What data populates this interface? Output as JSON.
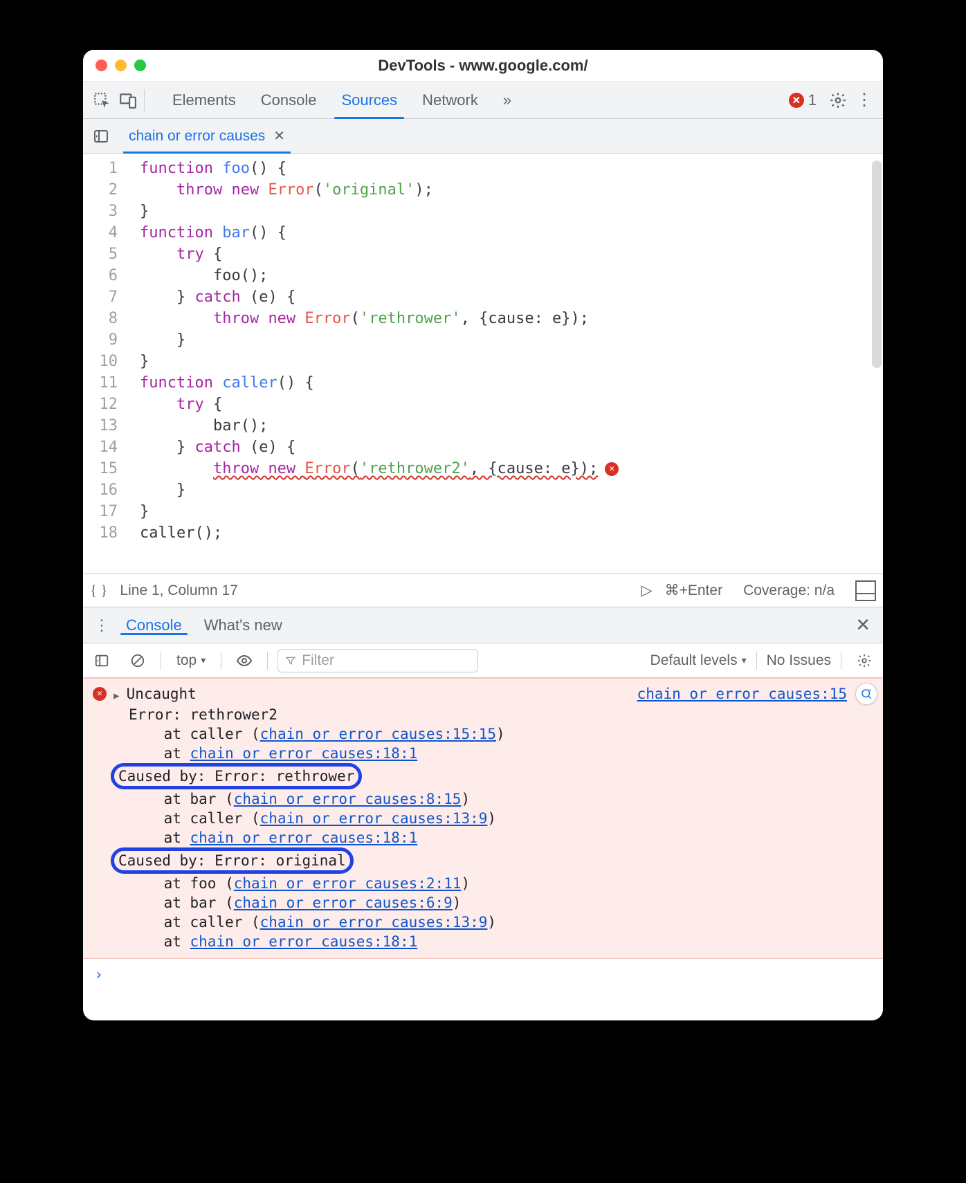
{
  "window": {
    "title": "DevTools - www.google.com/"
  },
  "toolbar": {
    "tabs": [
      "Elements",
      "Console",
      "Sources",
      "Network"
    ],
    "active_tab_index": 2,
    "overflow_glyph": "»",
    "error_count": "1"
  },
  "file_tabs": {
    "active": {
      "name": "chain or error causes",
      "close_glyph": "✕"
    }
  },
  "editor": {
    "line_numbers": [
      "1",
      "2",
      "3",
      "4",
      "5",
      "6",
      "7",
      "8",
      "9",
      "10",
      "11",
      "12",
      "13",
      "14",
      "15",
      "16",
      "17",
      "18"
    ],
    "code_tokens": [
      [
        {
          "t": "function ",
          "c": "kw"
        },
        {
          "t": "foo",
          "c": "fn"
        },
        {
          "t": "() {",
          "c": "pn"
        }
      ],
      [
        {
          "t": "    ",
          "c": ""
        },
        {
          "t": "throw new ",
          "c": "kw"
        },
        {
          "t": "Error",
          "c": "nm"
        },
        {
          "t": "(",
          "c": "pn"
        },
        {
          "t": "'original'",
          "c": "str"
        },
        {
          "t": ");",
          "c": "pn"
        }
      ],
      [
        {
          "t": "}",
          "c": "pn"
        }
      ],
      [
        {
          "t": "function ",
          "c": "kw"
        },
        {
          "t": "bar",
          "c": "fn"
        },
        {
          "t": "() {",
          "c": "pn"
        }
      ],
      [
        {
          "t": "    ",
          "c": ""
        },
        {
          "t": "try ",
          "c": "kw"
        },
        {
          "t": "{",
          "c": "pn"
        }
      ],
      [
        {
          "t": "        foo();",
          "c": "pn"
        }
      ],
      [
        {
          "t": "    } ",
          "c": "pn"
        },
        {
          "t": "catch ",
          "c": "kw"
        },
        {
          "t": "(e) {",
          "c": "pn"
        }
      ],
      [
        {
          "t": "        ",
          "c": ""
        },
        {
          "t": "throw new ",
          "c": "kw"
        },
        {
          "t": "Error",
          "c": "nm"
        },
        {
          "t": "(",
          "c": "pn"
        },
        {
          "t": "'rethrower'",
          "c": "str"
        },
        {
          "t": ", {cause: e});",
          "c": "pn"
        }
      ],
      [
        {
          "t": "    }",
          "c": "pn"
        }
      ],
      [
        {
          "t": "}",
          "c": "pn"
        }
      ],
      [
        {
          "t": "function ",
          "c": "kw"
        },
        {
          "t": "caller",
          "c": "fn"
        },
        {
          "t": "() {",
          "c": "pn"
        }
      ],
      [
        {
          "t": "    ",
          "c": ""
        },
        {
          "t": "try ",
          "c": "kw"
        },
        {
          "t": "{",
          "c": "pn"
        }
      ],
      [
        {
          "t": "        bar();",
          "c": "pn"
        }
      ],
      [
        {
          "t": "    } ",
          "c": "pn"
        },
        {
          "t": "catch ",
          "c": "kw"
        },
        {
          "t": "(e) {",
          "c": "pn"
        }
      ],
      [
        {
          "t": "        ",
          "c": ""
        },
        {
          "t": "throw new ",
          "c": "kw",
          "sq": true
        },
        {
          "t": "Error",
          "c": "nm",
          "sq": true
        },
        {
          "t": "(",
          "c": "pn",
          "sq": true
        },
        {
          "t": "'rethrower2'",
          "c": "str",
          "sq": true
        },
        {
          "t": ", {cause: e});",
          "c": "pn",
          "sq": true
        }
      ],
      [
        {
          "t": "    }",
          "c": "pn"
        }
      ],
      [
        {
          "t": "}",
          "c": "pn"
        }
      ],
      [
        {
          "t": "caller();",
          "c": "pn"
        }
      ]
    ],
    "error_line_index": 14
  },
  "status": {
    "braces": "{ }",
    "position": "Line 1, Column 17",
    "run_glyph": "▷",
    "run_hint": "⌘+Enter",
    "coverage": "Coverage: n/a"
  },
  "drawer": {
    "tabs": [
      "Console",
      "What's new"
    ],
    "active_index": 0,
    "dots": "⋮",
    "close": "✕"
  },
  "console_toolbar": {
    "context": "top",
    "context_arrow": "▾",
    "filter_placeholder": "Filter",
    "levels": "Default levels",
    "levels_arrow": "▾",
    "issues": "No Issues"
  },
  "console": {
    "source_link": "chain or error causes:15",
    "error_header": "Uncaught",
    "lines": [
      "Error: rethrower2",
      "    at caller (|chain or error causes:15:15|)",
      "    at |chain or error causes:18:1|",
      "[[Caused by: Error: rethrower]]",
      "    at bar (|chain or error causes:8:15|)",
      "    at caller (|chain or error causes:13:9|)",
      "    at |chain or error causes:18:1|",
      "[[Caused by: Error: original]]",
      "    at foo (|chain or error causes:2:11|)",
      "    at bar (|chain or error causes:6:9|)",
      "    at caller (|chain or error causes:13:9|)",
      "    at |chain or error causes:18:1|"
    ],
    "prompt": "›"
  }
}
